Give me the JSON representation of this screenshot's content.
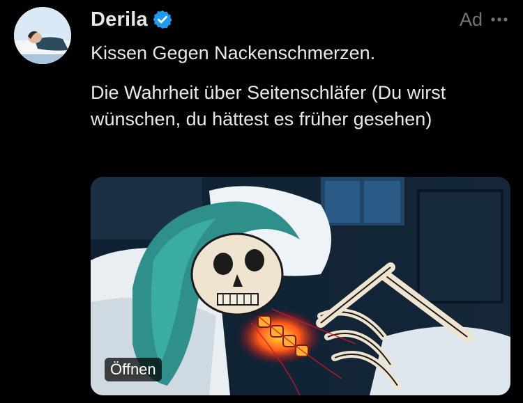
{
  "post": {
    "author_name": "Derila",
    "verified": true,
    "ad_label": "Ad",
    "headline": "Kissen Gegen Nackenschmerzen.",
    "body": "Die Wahrheit über Seitenschläfer (Du wirst wünschen, du hättest es früher gesehen)",
    "media_button_label": "Öffnen"
  },
  "colors": {
    "background": "#000000",
    "text_primary": "#e7e9ea",
    "text_secondary": "#71767b",
    "verified_blue": "#1d9bf0"
  },
  "icons": {
    "verified": "verified-badge-icon",
    "more": "more-horizontal-icon"
  }
}
